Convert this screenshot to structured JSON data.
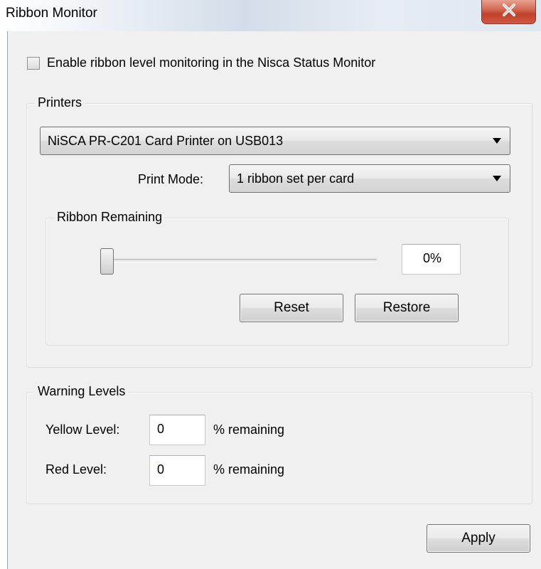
{
  "window": {
    "title": "Ribbon Monitor",
    "close_glyph": "X"
  },
  "enable_monitoring": {
    "label": "Enable ribbon level monitoring in the Nisca Status Monitor",
    "checked": false
  },
  "printers": {
    "legend": "Printers",
    "printer_select": "NiSCA PR-C201 Card Printer on USB013",
    "print_mode_label": "Print Mode:",
    "print_mode_select": "1 ribbon set per card"
  },
  "ribbon_remaining": {
    "legend": "Ribbon Remaining",
    "slider_value_percent": 0,
    "value_text": "0%",
    "reset_label": "Reset",
    "restore_label": "Restore"
  },
  "warning_levels": {
    "legend": "Warning Levels",
    "yellow_label": "Yellow Level:",
    "yellow_value": "0",
    "yellow_suffix": "% remaining",
    "red_label": "Red Level:",
    "red_value": "0",
    "red_suffix": "% remaining"
  },
  "apply_label": "Apply",
  "colors": {
    "close_button": "#c9503b",
    "dialog_background": "#f0f0f0"
  }
}
